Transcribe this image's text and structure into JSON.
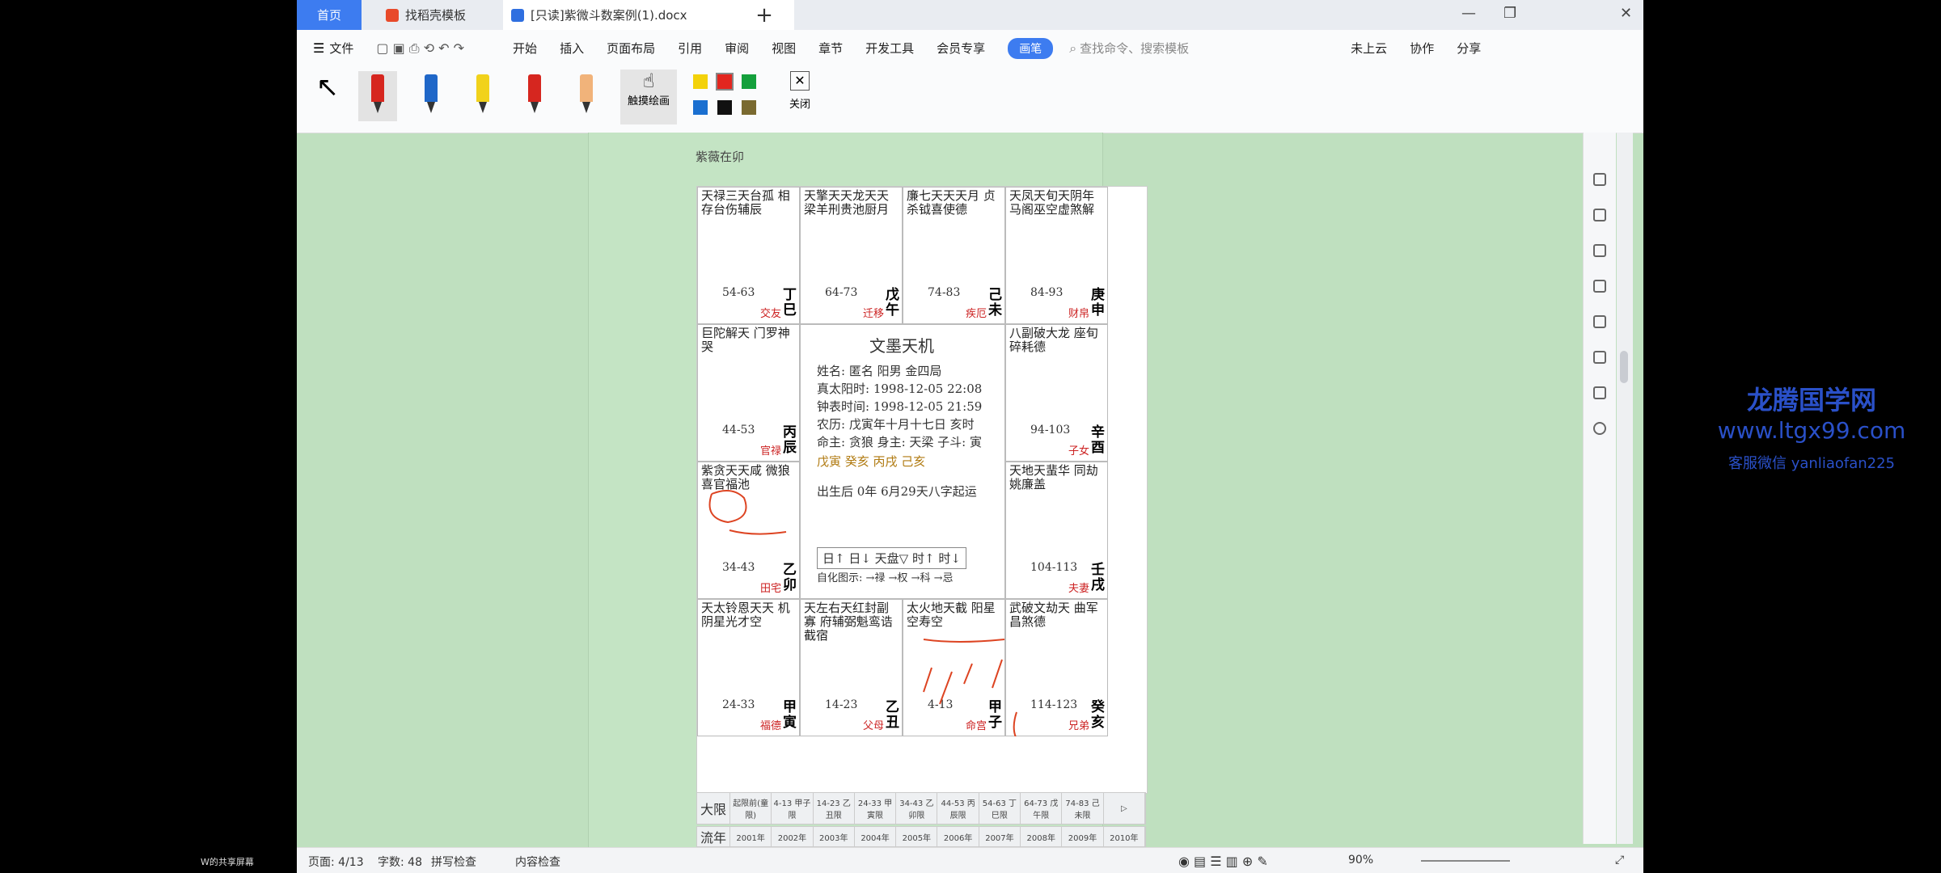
{
  "tabs": [
    {
      "label": "首页"
    },
    {
      "label": "找稻壳模板"
    },
    {
      "label": "[只读]紫微斗数案例(1).docx"
    }
  ],
  "menu": [
    "文件",
    "开始",
    "插入",
    "页面布局",
    "引用",
    "审阅",
    "视图",
    "章节",
    "开发工具",
    "会员专享"
  ],
  "pen_label": "画笔",
  "search_placeholder": "查找命令、搜索模板",
  "right_menu": {
    "cloud": "未上云",
    "collab": "协作",
    "share": "分享"
  },
  "tools": {
    "touch_draw": "触摸绘画",
    "close": "关闭"
  },
  "swatch_colors": [
    "#f3d20a",
    "#e3261f",
    "#14a03c",
    "#1a6fd0",
    "#111111",
    "#7a6a30"
  ],
  "pen_colors": [
    "#d6261f",
    "#1f67c8",
    "#f1d21b",
    "#d6261f",
    "#f1b37a"
  ],
  "doc": {
    "heading": "紫薇在卯"
  },
  "palaces": [
    {
      "stars": "天禄三天台孤 相存台伤辅辰",
      "age": "54-63",
      "gz": "丁巳",
      "name": "交友"
    },
    {
      "stars": "天擎天天龙天天 梁羊刑贵池厨月",
      "age": "64-73",
      "gz": "戊午",
      "name": "迁移"
    },
    {
      "stars": "廉七天天天月 贞杀钺喜使德",
      "age": "74-83",
      "gz": "己未",
      "name": "疾厄"
    },
    {
      "stars": "天凤天旬天阴年 马阁巫空虚煞解",
      "age": "84-93",
      "gz": "庚申",
      "name": "财帛"
    },
    {
      "stars": "巨陀解天 门罗神哭",
      "age": "44-53",
      "gz": "丙辰",
      "name": "官禄"
    },
    {
      "stars": "八副破大龙 座旬碎耗德",
      "age": "94-103",
      "gz": "辛酉",
      "name": "子女"
    },
    {
      "stars": "紫贪天天咸 微狼喜官福池",
      "age": "34-43",
      "gz": "乙卯",
      "name": "田宅"
    },
    {
      "stars": "天地天蜚华 同劫姚廉盖",
      "age": "104-113",
      "gz": "壬戌",
      "name": "夫妻"
    },
    {
      "stars": "天太铃恩天天 机阴星光才空",
      "age": "24-33",
      "gz": "甲寅",
      "name": "福德"
    },
    {
      "stars": "天左右天红封副寡 府辅弼魁鸾诰截宿",
      "age": "14-23",
      "gz": "乙丑",
      "name": "父母"
    },
    {
      "stars": "太火地天截 阳星空寿空",
      "age": "4-13",
      "gz": "甲子",
      "name": "命宫"
    },
    {
      "stars": "武破文劫天 曲军昌煞德",
      "age": "114-123",
      "gz": "癸亥",
      "name": "兄弟"
    }
  ],
  "center": {
    "title": "文墨天机",
    "name": "姓名: 匿名      阳男  金四局",
    "solar": "真太阳时: 1998-12-05 22:08",
    "clock": "钟表时间: 1998-12-05 21:59",
    "lunar": "农历: 戊寅年十月十七日 亥时",
    "master": "命主: 贪狼 身主: 天梁 子斗: 寅",
    "pillars": "戊寅  癸亥  丙戌  己亥",
    "birth": "出生后 0年 6月29天八字起运",
    "buttons": "日↑  日↓  天盘▽  时↑  时↓",
    "legend": "自化图示: →禄 →权 →科 →忌"
  },
  "daxian": {
    "label1": "大限",
    "cells1": [
      "起限前(童限)",
      "4-13 甲子限",
      "14-23 乙丑限",
      "24-33 甲寅限",
      "34-43 乙卯限",
      "44-53 丙辰限",
      "54-63 丁巳限",
      "64-73 戊午限",
      "74-83 己未限",
      "▷"
    ],
    "label2": "流年",
    "cells2": [
      "2001年",
      "2002年",
      "2003年",
      "2004年",
      "2005年",
      "2006年",
      "2007年",
      "2008年",
      "2009年",
      "2010年"
    ]
  },
  "status": {
    "page": "页面: 4/13",
    "words": "字数: 48",
    "spell": "拼写检查",
    "content": "内容检查",
    "zoom": "90%"
  },
  "watermark": {
    "name": "龙腾国学网",
    "url": "www.ltgx99.com",
    "contact": "客服微信 yanliaofan225"
  },
  "share_label": "W的共享屏幕"
}
